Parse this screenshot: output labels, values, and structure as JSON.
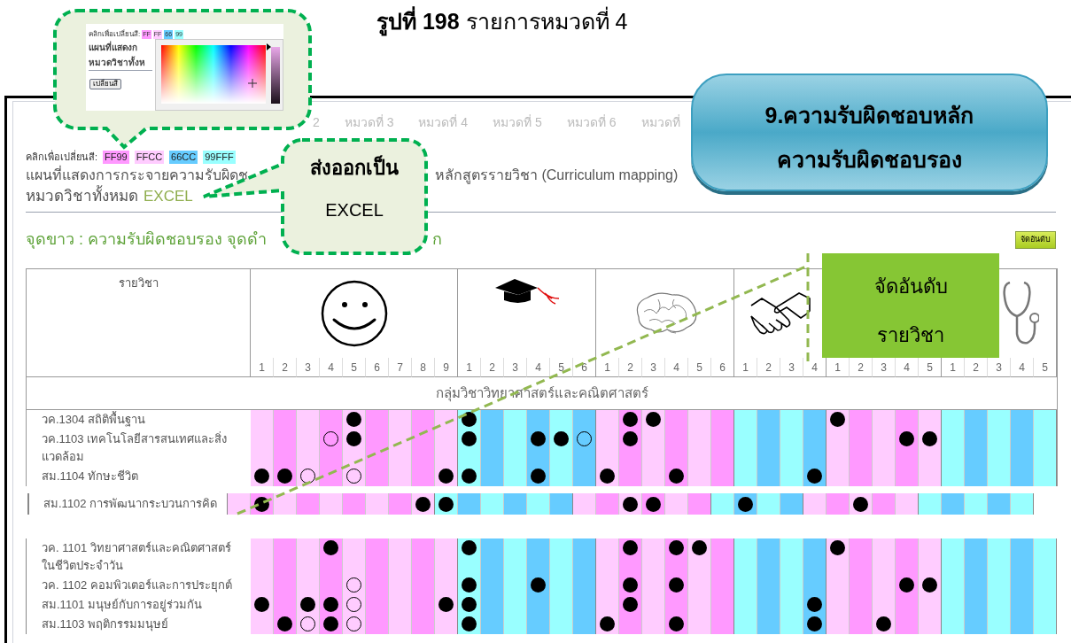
{
  "caption": "**รูปที่ 198** รายการหมวดที่ 4",
  "picker_bubble": {
    "label": "คลิกเพื่อเปลี่ยนสี:",
    "swatches": [
      {
        "label": "FF",
        "color": "#ff99ff"
      },
      {
        "label": "FF",
        "color": "#ffccff"
      },
      {
        "label": "66",
        "color": "#66ccff"
      },
      {
        "label": "99",
        "color": "#99ffff"
      }
    ],
    "lines": [
      "แผนที่แสดงก",
      "หมวดวิชาทั้งห"
    ],
    "button": "เปลี่ยนสี",
    "slider": {
      "level": 1
    }
  },
  "export_bubble": {
    "lines": [
      "ส่งออกเป็น",
      "EXCEL"
    ]
  },
  "responsibility_callout": {
    "lines": [
      "9.ความรับผิดชอบหลัก",
      "ความรับผิดชอบรอง"
    ]
  },
  "sort_callout": {
    "lines": [
      "จัดอันดับ",
      "รายวิชา"
    ]
  },
  "tabs": [
    "2",
    "หมวดที่ 3",
    "หมวดที่ 4",
    "หมวดที่ 5",
    "หมวดที่ 6",
    "หมวดที่"
  ],
  "color_bar": {
    "label": "คลิกเพื่อเปลี่ยนสี:",
    "swatches": [
      {
        "label": "FF99",
        "color": "#ff99ff"
      },
      {
        "label": "FFCC",
        "color": "#ffccff"
      },
      {
        "label": "66CC",
        "color": "#66ccff"
      },
      {
        "label": "99FFF",
        "color": "#99ffff"
      }
    ]
  },
  "title_parts": [
    "แผนที่แสดงการกระจายความรับผิดช",
    "หลักสูตรรายวิชา (Curriculum mapping)"
  ],
  "category": {
    "label": "หมวดวิชาทั้งหมด",
    "link": "EXCEL"
  },
  "legend_parts": [
    "จุดขาว : ความรับผิดชอบรอง จุดดำ",
    "ก"
  ],
  "sort_button": "จัดอันดับ",
  "table": {
    "header": "รายวิชา",
    "groups": [
      {
        "kind": "smiley",
        "numbers": [
          "1",
          "2",
          "3",
          "4",
          "5",
          "6",
          "7",
          "8",
          "9"
        ]
      },
      {
        "kind": "cap",
        "numbers": [
          "1",
          "2",
          "3",
          "4",
          "5",
          "6"
        ]
      },
      {
        "kind": "brain",
        "numbers": [
          "1",
          "2",
          "3",
          "4",
          "5",
          "6"
        ]
      },
      {
        "kind": "handshake",
        "numbers": [
          "1",
          "2",
          "3",
          "4"
        ]
      },
      {
        "kind": "hidden",
        "numbers": [
          "1",
          "2",
          "3",
          "4",
          "5"
        ]
      },
      {
        "kind": "stethoscope",
        "numbers": [
          "1",
          "2",
          "3",
          "4",
          "5"
        ]
      }
    ],
    "group_heading": "กลุ่มวิชาวิทยาศาสตร์และคณิตศาสตร์",
    "rows": [
      {
        "name": "วค.1304 สถิติพื้นฐาน",
        "cells": [
          {
            "dot": false
          },
          {
            "dot": false
          },
          {
            "dot": false
          },
          {
            "dot": false
          },
          {
            "dot": true,
            "filled": true
          },
          {
            "dot": false
          },
          {
            "dot": false
          },
          {
            "dot": false
          },
          {
            "dot": false
          },
          {
            "dot": true,
            "filled": true
          },
          {
            "dot": false
          },
          {
            "dot": false
          },
          {
            "dot": false
          },
          {
            "dot": false
          },
          {
            "dot": false
          },
          {
            "dot": false
          },
          {
            "dot": true,
            "filled": true
          },
          {
            "dot": true,
            "filled": true
          },
          {
            "dot": false
          },
          {
            "dot": false
          },
          {
            "dot": false
          },
          {
            "dot": false
          },
          {
            "dot": false
          },
          {
            "dot": false
          },
          {
            "dot": false
          },
          {
            "dot": true,
            "filled": true
          },
          {
            "dot": false
          },
          {
            "dot": false
          },
          {
            "dot": false
          },
          {
            "dot": false
          },
          {
            "dot": false
          },
          {
            "dot": false
          },
          {
            "dot": false
          },
          {
            "dot": false
          },
          {
            "dot": false
          }
        ]
      },
      {
        "name": "วค.1103 เทคโนโลยีสารสนเทศและสิ่งแวดล้อม",
        "cells": [
          {
            "dot": false
          },
          {
            "dot": false
          },
          {
            "dot": false
          },
          {
            "dot": true,
            "filled": false
          },
          {
            "dot": true,
            "filled": true
          },
          {
            "dot": false
          },
          {
            "dot": false
          },
          {
            "dot": false
          },
          {
            "dot": false
          },
          {
            "dot": true,
            "filled": true
          },
          {
            "dot": false
          },
          {
            "dot": false
          },
          {
            "dot": true,
            "filled": true
          },
          {
            "dot": true,
            "filled": true
          },
          {
            "dot": true,
            "filled": false
          },
          {
            "dot": false
          },
          {
            "dot": true,
            "filled": true
          },
          {
            "dot": false
          },
          {
            "dot": false
          },
          {
            "dot": false
          },
          {
            "dot": false
          },
          {
            "dot": false
          },
          {
            "dot": false
          },
          {
            "dot": false
          },
          {
            "dot": false
          },
          {
            "dot": false
          },
          {
            "dot": false
          },
          {
            "dot": false
          },
          {
            "dot": true,
            "filled": true
          },
          {
            "dot": true,
            "filled": true
          },
          {
            "dot": false
          },
          {
            "dot": false
          },
          {
            "dot": false
          },
          {
            "dot": false
          },
          {
            "dot": false
          }
        ]
      },
      {
        "name": "สม.1104 ทักษะชีวิต",
        "cells": [
          {
            "dot": true,
            "filled": true
          },
          {
            "dot": true,
            "filled": true
          },
          {
            "dot": true,
            "filled": false
          },
          {
            "dot": false
          },
          {
            "dot": true,
            "filled": false
          },
          {
            "dot": false
          },
          {
            "dot": false
          },
          {
            "dot": false
          },
          {
            "dot": true,
            "filled": true
          },
          {
            "dot": true,
            "filled": true
          },
          {
            "dot": false
          },
          {
            "dot": false
          },
          {
            "dot": true,
            "filled": true
          },
          {
            "dot": false
          },
          {
            "dot": false
          },
          {
            "dot": true,
            "filled": true
          },
          {
            "dot": false
          },
          {
            "dot": false
          },
          {
            "dot": true,
            "filled": true
          },
          {
            "dot": false
          },
          {
            "dot": false
          },
          {
            "dot": false
          },
          {
            "dot": false
          },
          {
            "dot": false
          },
          {
            "dot": true,
            "filled": true
          },
          {
            "dot": false
          },
          {
            "dot": false
          },
          {
            "dot": false
          },
          {
            "dot": false
          },
          {
            "dot": false
          },
          {
            "dot": false
          },
          {
            "dot": false
          },
          {
            "dot": false
          },
          {
            "dot": false
          },
          {
            "dot": false
          }
        ]
      }
    ],
    "dragged_row": {
      "name": "สม.1102 การพัฒนากระบวนการคิด",
      "cells": [
        {
          "dot": false
        },
        {
          "dot": true,
          "filled": true
        },
        {
          "dot": false
        },
        {
          "dot": false
        },
        {
          "dot": false
        },
        {
          "dot": false
        },
        {
          "dot": false
        },
        {
          "dot": false
        },
        {
          "dot": true,
          "filled": true
        },
        {
          "dot": true,
          "filled": true
        },
        {
          "dot": false
        },
        {
          "dot": false
        },
        {
          "dot": false
        },
        {
          "dot": false
        },
        {
          "dot": false
        },
        {
          "dot": false
        },
        {
          "dot": false
        },
        {
          "dot": true,
          "filled": true
        },
        {
          "dot": true,
          "filled": true
        },
        {
          "dot": false
        },
        {
          "dot": false
        },
        {
          "dot": false
        },
        {
          "dot": true,
          "filled": true
        },
        {
          "dot": false
        },
        {
          "dot": false
        },
        {
          "dot": false
        },
        {
          "dot": false
        },
        {
          "dot": true,
          "filled": true
        },
        {
          "dot": false
        },
        {
          "dot": false
        },
        {
          "dot": false
        },
        {
          "dot": false
        },
        {
          "dot": false
        },
        {
          "dot": false
        },
        {
          "dot": false
        }
      ]
    },
    "rows_lower": [
      {
        "name": "วค. 1101 วิทยาศาสตร์และคณิตศาสตร์ในชีวิตประจำวัน",
        "cells": [
          {
            "dot": false
          },
          {
            "dot": false
          },
          {
            "dot": false
          },
          {
            "dot": true,
            "filled": true
          },
          {
            "dot": false
          },
          {
            "dot": false
          },
          {
            "dot": false
          },
          {
            "dot": false
          },
          {
            "dot": false
          },
          {
            "dot": true,
            "filled": true
          },
          {
            "dot": false
          },
          {
            "dot": false
          },
          {
            "dot": false
          },
          {
            "dot": false
          },
          {
            "dot": false
          },
          {
            "dot": false
          },
          {
            "dot": true,
            "filled": true
          },
          {
            "dot": false
          },
          {
            "dot": true,
            "filled": true
          },
          {
            "dot": true,
            "filled": true
          },
          {
            "dot": false
          },
          {
            "dot": false
          },
          {
            "dot": false
          },
          {
            "dot": false
          },
          {
            "dot": false
          },
          {
            "dot": true,
            "filled": true
          },
          {
            "dot": false
          },
          {
            "dot": false
          },
          {
            "dot": false
          },
          {
            "dot": false
          },
          {
            "dot": false
          },
          {
            "dot": false
          },
          {
            "dot": false
          },
          {
            "dot": false
          },
          {
            "dot": false
          }
        ]
      },
      {
        "name": "วค. 1102 คอมพิวเตอร์และการประยุกต์",
        "cells": [
          {
            "dot": false
          },
          {
            "dot": false
          },
          {
            "dot": false
          },
          {
            "dot": false
          },
          {
            "dot": true,
            "filled": false
          },
          {
            "dot": false
          },
          {
            "dot": false
          },
          {
            "dot": false
          },
          {
            "dot": false
          },
          {
            "dot": true,
            "filled": true
          },
          {
            "dot": false
          },
          {
            "dot": false
          },
          {
            "dot": true,
            "filled": true
          },
          {
            "dot": false
          },
          {
            "dot": false
          },
          {
            "dot": false
          },
          {
            "dot": true,
            "filled": true
          },
          {
            "dot": false
          },
          {
            "dot": true,
            "filled": true
          },
          {
            "dot": false
          },
          {
            "dot": false
          },
          {
            "dot": false
          },
          {
            "dot": false
          },
          {
            "dot": false
          },
          {
            "dot": false
          },
          {
            "dot": false
          },
          {
            "dot": false
          },
          {
            "dot": false
          },
          {
            "dot": true,
            "filled": true
          },
          {
            "dot": true,
            "filled": true
          },
          {
            "dot": false
          },
          {
            "dot": false
          },
          {
            "dot": false
          },
          {
            "dot": false
          },
          {
            "dot": false
          }
        ]
      },
      {
        "name": "สม.1101 มนุษย์กับการอยู่ร่วมกัน",
        "cells": [
          {
            "dot": true,
            "filled": true
          },
          {
            "dot": false
          },
          {
            "dot": true,
            "filled": true
          },
          {
            "dot": true,
            "filled": true
          },
          {
            "dot": true,
            "filled": false
          },
          {
            "dot": false
          },
          {
            "dot": false
          },
          {
            "dot": false
          },
          {
            "dot": true,
            "filled": true
          },
          {
            "dot": true,
            "filled": true
          },
          {
            "dot": false
          },
          {
            "dot": false
          },
          {
            "dot": false
          },
          {
            "dot": false
          },
          {
            "dot": false
          },
          {
            "dot": false
          },
          {
            "dot": true,
            "filled": true
          },
          {
            "dot": false
          },
          {
            "dot": false
          },
          {
            "dot": false
          },
          {
            "dot": false
          },
          {
            "dot": false
          },
          {
            "dot": false
          },
          {
            "dot": false
          },
          {
            "dot": true,
            "filled": true
          },
          {
            "dot": false
          },
          {
            "dot": false
          },
          {
            "dot": false
          },
          {
            "dot": false
          },
          {
            "dot": false
          },
          {
            "dot": false
          },
          {
            "dot": false
          },
          {
            "dot": false
          },
          {
            "dot": false
          },
          {
            "dot": false
          }
        ]
      },
      {
        "name": "สม.1103 พฤติกรรมมนุษย์",
        "cells": [
          {
            "dot": false
          },
          {
            "dot": true,
            "filled": true
          },
          {
            "dot": true,
            "filled": false
          },
          {
            "dot": true,
            "filled": true
          },
          {
            "dot": true,
            "filled": false
          },
          {
            "dot": false
          },
          {
            "dot": false
          },
          {
            "dot": false
          },
          {
            "dot": false
          },
          {
            "dot": true,
            "filled": true
          },
          {
            "dot": false
          },
          {
            "dot": false
          },
          {
            "dot": false
          },
          {
            "dot": false
          },
          {
            "dot": false
          },
          {
            "dot": true,
            "filled": true
          },
          {
            "dot": false
          },
          {
            "dot": false
          },
          {
            "dot": true,
            "filled": true
          },
          {
            "dot": false
          },
          {
            "dot": false
          },
          {
            "dot": false
          },
          {
            "dot": false
          },
          {
            "dot": false
          },
          {
            "dot": true,
            "filled": true
          },
          {
            "dot": false
          },
          {
            "dot": false
          },
          {
            "dot": true,
            "filled": true
          },
          {
            "dot": false
          },
          {
            "dot": false
          },
          {
            "dot": false
          },
          {
            "dot": false
          },
          {
            "dot": false
          },
          {
            "dot": false
          },
          {
            "dot": false
          }
        ]
      }
    ]
  }
}
